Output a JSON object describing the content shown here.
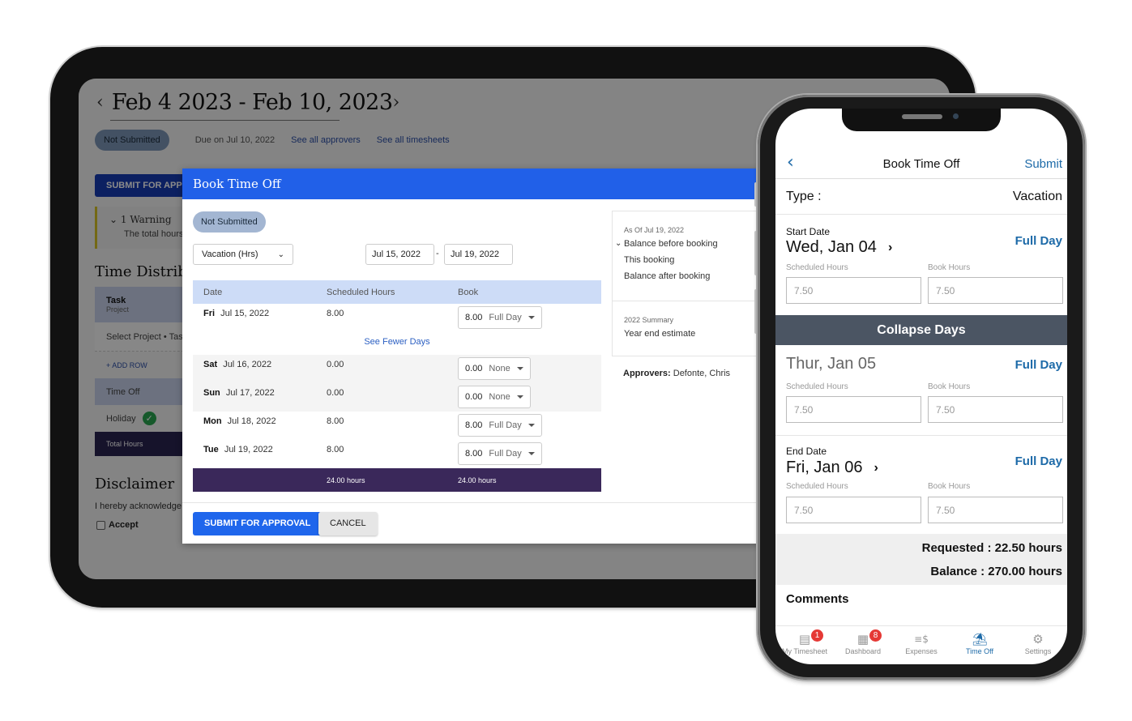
{
  "tablet": {
    "timesheet": {
      "prev_arrow": "‹",
      "next_arrow": "›",
      "title": "Feb 4 2023 - Feb 10, 2023",
      "status": "Not Submitted",
      "due": "Due on Jul 10, 2022",
      "see_approvers": "See all approvers",
      "see_timesheets": "See all timesheets",
      "submit_label": "SUBMIT FOR APPROVAL",
      "warning_title": "1 Warning",
      "warning_text": "The total hours",
      "section_title": "Time Distribution",
      "table": {
        "head_task": "Task",
        "head_project": "Project",
        "select_project": "Select Project • Task",
        "add_row": "+ ADD ROW",
        "time_off": "Time Off",
        "holiday": "Holiday",
        "total_hours": "Total Hours"
      },
      "disclaimer_title": "Disclaimer",
      "disclaimer_text": "I hereby acknowledge",
      "accept_label": "Accept"
    },
    "modal": {
      "title": "Book Time Off",
      "status": "Not Submitted",
      "type_select": "Vacation (Hrs)",
      "start_date": "Jul 15, 2022",
      "date_separator": "-",
      "end_date": "Jul 19, 2022",
      "columns": [
        "Date",
        "Scheduled Hours",
        "Book"
      ],
      "rows": [
        {
          "day": "Fri",
          "date": "Jul 15, 2022",
          "scheduled": "8.00",
          "book": "8.00",
          "unit": "Full Day"
        },
        {
          "day": "Sat",
          "date": "Jul 16, 2022",
          "scheduled": "0.00",
          "book": "0.00",
          "unit": "None"
        },
        {
          "day": "Sun",
          "date": "Jul 17, 2022",
          "scheduled": "0.00",
          "book": "0.00",
          "unit": "None"
        },
        {
          "day": "Mon",
          "date": "Jul 18, 2022",
          "scheduled": "8.00",
          "book": "8.00",
          "unit": "Full Day"
        },
        {
          "day": "Tue",
          "date": "Jul 19, 2022",
          "scheduled": "8.00",
          "book": "8.00",
          "unit": "Full Day"
        }
      ],
      "see_fewer": "See Fewer Days",
      "total_scheduled": "24.00 hours",
      "total_book": "24.00 hours",
      "submit_label": "SUBMIT FOR APPROVAL",
      "cancel_label": "CANCEL",
      "side": {
        "as_of": "As Of Jul 19, 2022",
        "balance_before": "Balance before booking",
        "this_booking": "This booking",
        "balance_after": "Balance after booking",
        "summary_caption": "2022 Summary",
        "year_end": "Year end estimate"
      },
      "approvers_label": "Approvers:",
      "approvers_value": "Defonte, Chris"
    }
  },
  "phone": {
    "nav": {
      "back": "‹",
      "title": "Book Time Off",
      "submit": "Submit"
    },
    "type_label": "Type :",
    "type_value": "Vacation",
    "days": [
      {
        "caption": "Start Date",
        "date": "Wed, Jan 04",
        "has_arrow": true,
        "mode": "Full Day",
        "scheduled_label": "Scheduled Hours",
        "book_label": "Book Hours",
        "scheduled": "7.50",
        "book": "7.50"
      },
      {
        "caption": "",
        "date": "Thur, Jan 05",
        "has_arrow": false,
        "mode": "Full Day",
        "scheduled_label": "Scheduled Hours",
        "book_label": "Book Hours",
        "scheduled": "7.50",
        "book": "7.50"
      },
      {
        "caption": "End Date",
        "date": "Fri, Jan 06",
        "has_arrow": true,
        "mode": "Full Day",
        "scheduled_label": "Scheduled Hours",
        "book_label": "Book Hours",
        "scheduled": "7.50",
        "book": "7.50"
      }
    ],
    "collapse_label": "Collapse Days",
    "requested": "Requested :  22.50 hours",
    "balance": "Balance :  270.00 hours",
    "comments_label": "Comments",
    "tabs": [
      {
        "label": "My Timesheet",
        "icon": "timesheet-icon",
        "glyph": "▤",
        "badge": "1",
        "active": false
      },
      {
        "label": "Dashboard",
        "icon": "dashboard-icon",
        "glyph": "▦",
        "badge": "8",
        "active": false
      },
      {
        "label": "Expenses",
        "icon": "expenses-icon",
        "glyph": "≡$",
        "badge": "",
        "active": false
      },
      {
        "label": "Time Off",
        "icon": "time-off-icon",
        "glyph": "⛱",
        "badge": "",
        "active": true
      },
      {
        "label": "Settings",
        "icon": "settings-icon",
        "glyph": "⚙",
        "badge": "",
        "active": false
      }
    ]
  },
  "colors": {
    "modal_header": "#2160e8",
    "primary_button": "#1f66ec",
    "total_row": "#3a285a",
    "phone_accent": "#1d6aa8",
    "collapse_bar": "#4b5563",
    "badge": "#e53935"
  }
}
